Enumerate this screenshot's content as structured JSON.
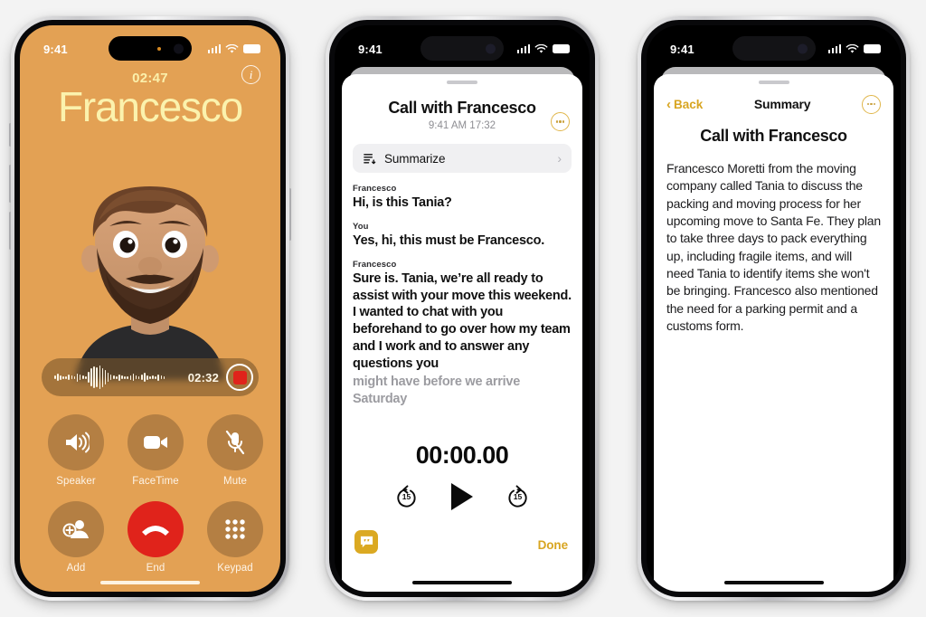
{
  "statusbar": {
    "time": "9:41",
    "wifi_icon": "wifi-icon",
    "cellular_icon": "cellular-bars-icon",
    "battery_icon": "battery-icon"
  },
  "phone1": {
    "name": "call-screen",
    "call_timer": "02:47",
    "caller_name": "Francesco",
    "info_icon": "info-icon",
    "avatar_icon": "memoji-avatar",
    "recording": {
      "time": "02:32",
      "waveform_icon": "audio-waveform",
      "stop_icon": "stop-record-icon"
    },
    "controls": [
      {
        "label": "Speaker",
        "icon": "speaker-icon"
      },
      {
        "label": "FaceTime",
        "icon": "video-camera-icon"
      },
      {
        "label": "Mute",
        "icon": "microphone-muted-icon"
      },
      {
        "label": "Add",
        "icon": "add-person-icon"
      },
      {
        "label": "End",
        "icon": "end-call-icon"
      },
      {
        "label": "Keypad",
        "icon": "keypad-grid-icon"
      }
    ],
    "accent_background": "#e3a154",
    "accent_name_color": "#fbf2ad",
    "end_button_color": "#e0231b"
  },
  "phone2": {
    "name": "call-transcript-sheet",
    "title": "Call with Francesco",
    "subtitle": "9:41 AM  17:32",
    "more_icon": "more-ellipsis-icon",
    "summarize": {
      "label": "Summarize",
      "icon": "summarize-lines-icon",
      "chevron": "chevron-right-icon"
    },
    "transcript": [
      {
        "speaker": "Francesco",
        "text": "Hi, is this Tania?",
        "faded": false
      },
      {
        "speaker": "You",
        "text": "Yes, hi, this must be Francesco.",
        "faded": false
      },
      {
        "speaker": "Francesco",
        "text": "Sure is. Tania, we’re all ready to assist with your move this weekend. I wanted to chat with you beforehand to go over how my team and I work and to answer any questions you ",
        "faded": false
      },
      {
        "speaker": "",
        "text": "might have before we arrive Saturday",
        "faded": true
      }
    ],
    "player": {
      "elapsed": "00:00.00",
      "skip_back_label": "15",
      "skip_forward_label": "15",
      "skip_back_icon": "skip-back-15-icon",
      "play_icon": "play-icon",
      "skip_forward_icon": "skip-forward-15-icon"
    },
    "live_caption_icon": "live-transcript-bubble-icon",
    "done_label": "Done",
    "accent_color": "#d8a521"
  },
  "phone3": {
    "name": "call-summary-sheet",
    "back_label": "Back",
    "back_icon": "chevron-left-icon",
    "nav_title": "Summary",
    "more_icon": "more-ellipsis-icon",
    "heading": "Call with Francesco",
    "body": "Francesco Moretti from the moving company called Tania to discuss the packing and moving process for her upcoming move to Santa Fe. They plan to take three days to pack everything up, including fragile items, and will need Tania to identify items she won't be bringing. Francesco also mentioned the need for a parking permit and a customs form.",
    "accent_color": "#d8a521"
  }
}
